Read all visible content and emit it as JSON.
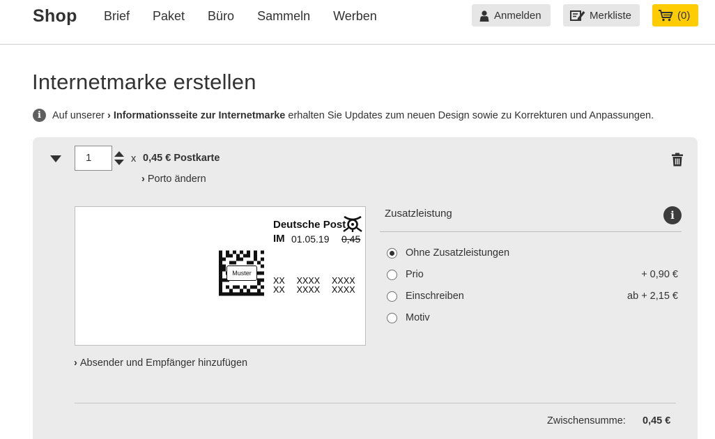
{
  "header": {
    "logo": "Shop",
    "nav": [
      "Brief",
      "Paket",
      "Büro",
      "Sammeln",
      "Werben"
    ],
    "login_label": "Anmelden",
    "merkliste_label": "Merkliste",
    "cart_label": "(0)",
    "cart_color": "#ffcc00"
  },
  "page": {
    "title": "Internetmarke erstellen",
    "info_prefix": "Auf unserer",
    "info_link": "Informationsseite zur Internetmarke",
    "info_suffix": "erhalten Sie Updates zum neuen Design sowie zu Korrekturen und Anpassungen."
  },
  "item": {
    "quantity": "1",
    "times": "x",
    "product": "0,45 € Postkarte",
    "porto_link": "Porto ändern",
    "absender_link": "Absender und Empfänger hinzufügen"
  },
  "stamp": {
    "brand": "Deutsche Post",
    "im": "IM",
    "date": "01.05.19",
    "price": "0,45",
    "muster": "Muster",
    "code_line_1": "XX  XXXX  XXXX",
    "code_line_2": "XX  XXXX  XXXX"
  },
  "zusatz": {
    "title": "Zusatzleistung",
    "options": [
      {
        "label": "Ohne Zusatzleistungen",
        "price": "",
        "checked": true
      },
      {
        "label": "Prio",
        "price": "+ 0,90 €",
        "checked": false
      },
      {
        "label": "Einschreiben",
        "price": "ab + 2,15 €",
        "checked": false
      },
      {
        "label": "Motiv",
        "price": "",
        "checked": false
      }
    ]
  },
  "summary": {
    "label": "Zwischensumme:",
    "value": "0,45 €"
  }
}
